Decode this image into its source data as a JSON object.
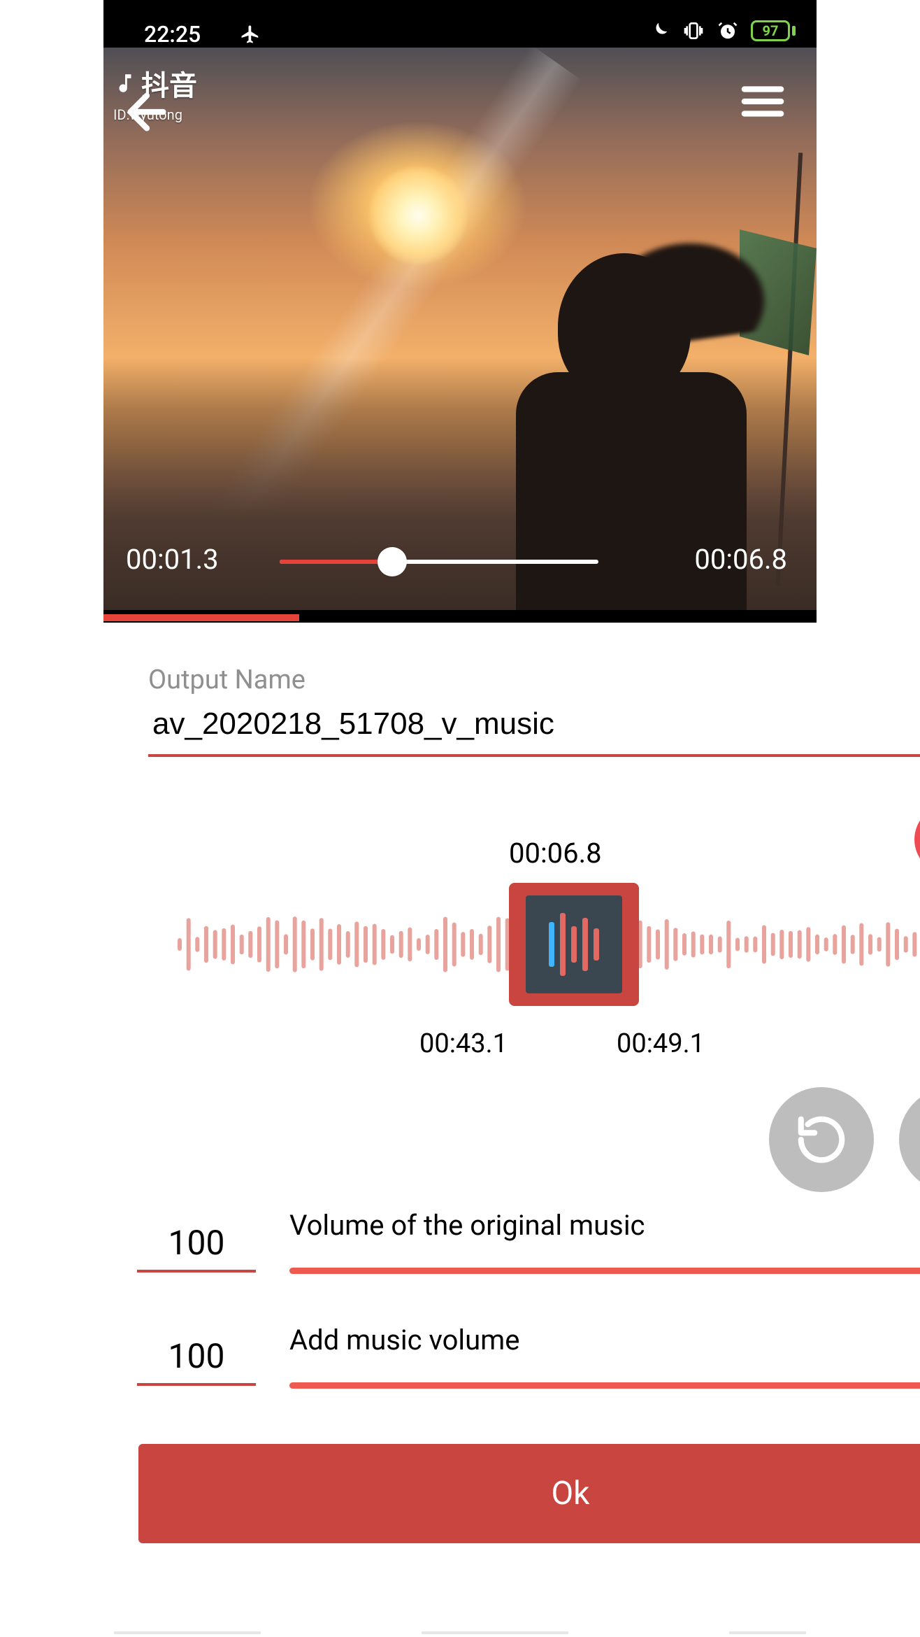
{
  "status": {
    "time": "22:25",
    "battery": "97"
  },
  "watermark": {
    "brand": "抖音",
    "id": "ID:wyutong"
  },
  "video": {
    "current_time": "00:01.3",
    "total_time": "00:06.8",
    "progress_fraction": 0.19
  },
  "output": {
    "label": "Output Name",
    "filename": "av_2020218_51708_v_music"
  },
  "audio_clip": {
    "video_segment_time": "00:06.8",
    "selection_start": "00:43.1",
    "selection_end": "00:49.1"
  },
  "volumes": {
    "original": {
      "label": "Volume of the original music",
      "value": "100",
      "fraction": 1.0
    },
    "added": {
      "label": "Add music volume",
      "value": "100",
      "fraction": 1.0
    }
  },
  "actions": {
    "ok": "Ok"
  },
  "icons": {
    "back": "back-arrow-icon",
    "menu": "hamburger-icon",
    "close": "close-icon",
    "restart": "restart-icon",
    "pause": "pause-icon",
    "airplane": "airplane-icon",
    "moon": "moon-icon",
    "vibrate": "vibrate-icon",
    "alarm": "alarm-icon"
  },
  "colors": {
    "accent": "#c9453f",
    "accent_light": "#ef5a50",
    "danger": "#f04a53",
    "grey": "#bdbdbd"
  }
}
